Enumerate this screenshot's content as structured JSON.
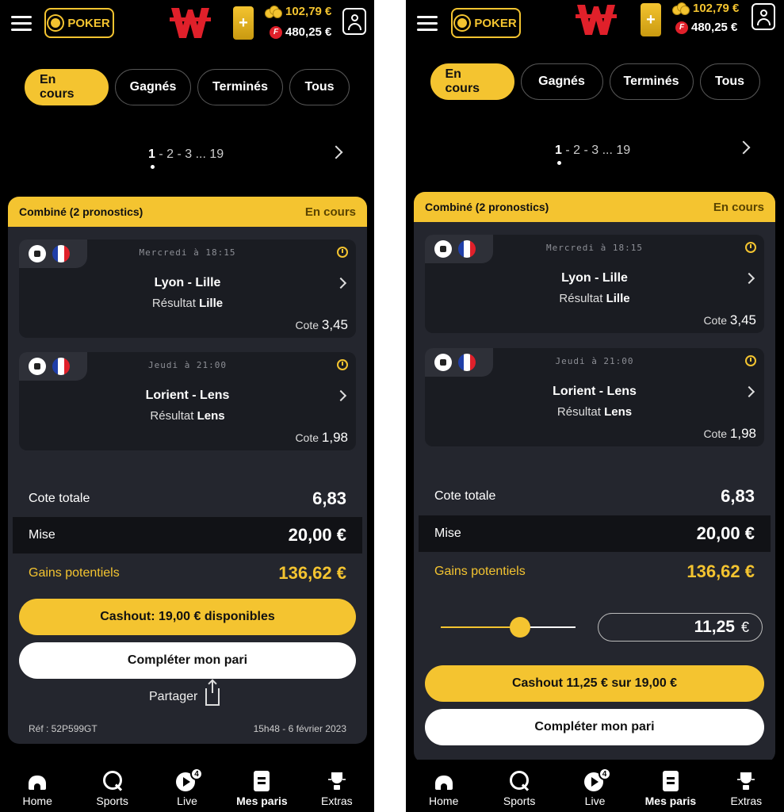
{
  "header": {
    "poker_label": "POKER",
    "coin_balance": "102,79 €",
    "free_balance": "480,25 €",
    "free_icon_letter": "F",
    "plus_label": "+"
  },
  "tabs": [
    "En cours",
    "Gagnés",
    "Terminés",
    "Tous"
  ],
  "pagination": {
    "current": "1",
    "rest": " - 2 - 3 ... 19"
  },
  "bet": {
    "title": "Combiné (2 pronostics)",
    "status": "En cours",
    "selections": [
      {
        "when": "Mercredi à 18:15",
        "match": "Lyon - Lille",
        "result_label": "Résultat",
        "result_value": "Lille",
        "cote_label": "Cote",
        "cote_value": "3,45"
      },
      {
        "when": "Jeudi à 21:00",
        "match": "Lorient - Lens",
        "result_label": "Résultat",
        "result_value": "Lens",
        "cote_label": "Cote",
        "cote_value": "1,98"
      }
    ],
    "total_odds_label": "Cote totale",
    "total_odds": "6,83",
    "stake_label": "Mise",
    "stake": "20,00 €",
    "gains_label": "Gains potentiels",
    "gains": "136,62 €"
  },
  "screen_a": {
    "cashout_label": "Cashout: 19,00 € disponibles",
    "complete_label": "Compléter mon pari",
    "share_label": "Partager",
    "ref": "Réf : 52P599GT",
    "date": "15h48 - 6 février 2023"
  },
  "screen_b": {
    "slider_fraction": 0.59,
    "cashout_amount": "11,25",
    "currency": "€",
    "cashout_label": "Cashout 11,25 € sur 19,00 €",
    "complete_label": "Compléter mon pari"
  },
  "bottom_nav": [
    {
      "label": "Home",
      "icon": "home-icon"
    },
    {
      "label": "Sports",
      "icon": "search-icon"
    },
    {
      "label": "Live",
      "icon": "live-play-icon",
      "badge": "4"
    },
    {
      "label": "Mes paris",
      "icon": "bet-slip-icon",
      "active": true
    },
    {
      "label": "Extras",
      "icon": "trophy-icon"
    }
  ],
  "colors": {
    "accent": "#f4c430",
    "card": "#24262e",
    "bet_item": "#1a1c22",
    "background": "#000000",
    "logo_red": "#e0202a"
  }
}
